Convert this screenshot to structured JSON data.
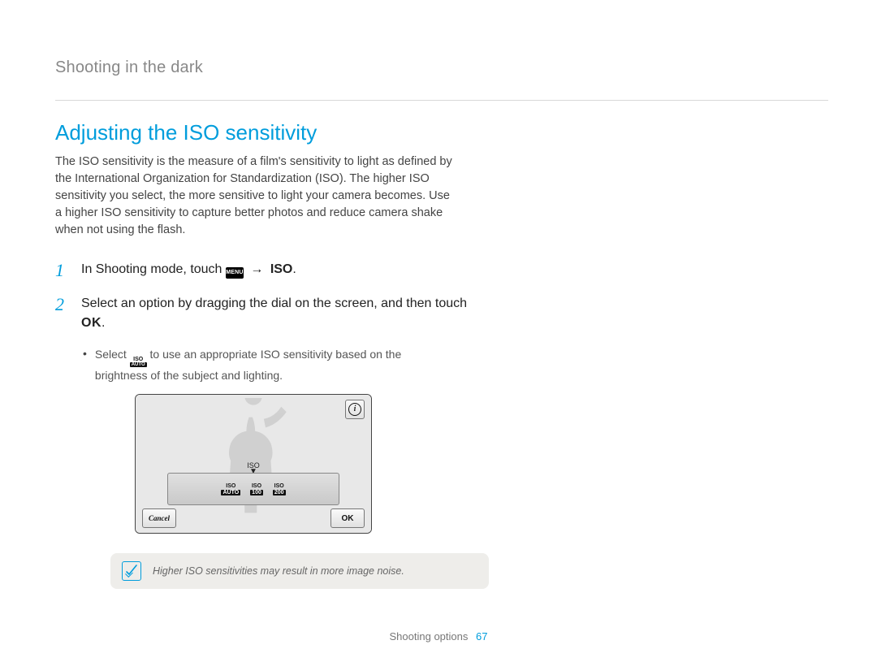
{
  "breadcrumb": "Shooting in the dark",
  "title": "Adjusting the ISO sensitivity",
  "intro": "The ISO sensitivity is the measure of a film's sensitivity to light as defined by the International Organization for Standardization (ISO). The higher ISO sensitivity you select, the more sensitive to light your camera becomes. Use a higher ISO sensitivity to capture better photos and reduce camera shake when not using the flash.",
  "steps": [
    {
      "num": "1",
      "pre": "In Shooting mode, touch ",
      "menu_badge": "MENU",
      "arrow": "→",
      "post_bold": "ISO",
      "tail": "."
    },
    {
      "num": "2",
      "line1": "Select an option by dragging the dial on the screen, and then touch ",
      "ok": "OK",
      "tail": "."
    }
  ],
  "subbullet": {
    "pre": "Select ",
    "icon_top": "ISO",
    "icon_bot": "AUTO",
    "post": " to use an appropriate ISO sensitivity based on the brightness of the subject and lighting."
  },
  "device": {
    "iso_label": "ISO",
    "info": "i",
    "cancel": "Cancel",
    "ok": "OK",
    "dial": [
      {
        "top": "ISO",
        "bot": "AUTO"
      },
      {
        "top": "ISO",
        "bot": "100"
      },
      {
        "top": "ISO",
        "bot": "200"
      }
    ]
  },
  "note": "Higher ISO sensitivities may result in more image noise.",
  "footer": {
    "section": "Shooting options",
    "page": "67"
  }
}
